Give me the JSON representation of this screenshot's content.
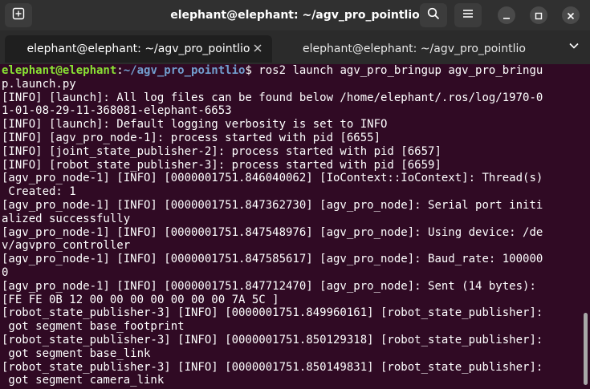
{
  "window": {
    "title": "elephant@elephant: ~/agv_pro_pointlio"
  },
  "tabs": [
    {
      "label": "elephant@elephant: ~/agv_pro_pointlio",
      "active": true
    },
    {
      "label": "elephant@elephant: ~/agv_pro_pointlio",
      "active": false
    }
  ],
  "icons": {
    "new_tab": "new-tab-icon",
    "search": "search-icon",
    "menu": "hamburger-menu-icon",
    "minimize": "minimize-icon",
    "maximize": "maximize-icon",
    "close": "close-icon",
    "tab_close": "close-icon",
    "tab_menu": "chevron-down-icon"
  },
  "colors": {
    "terminal_bg": "#300a24",
    "prompt_user": "#8ae234",
    "prompt_path": "#729fcf",
    "text": "#ffffff"
  },
  "terminal": {
    "prompt_user": "elephant@elephant",
    "prompt_sep": ":",
    "prompt_path": "~/agv_pro_pointlio",
    "prompt_cmd": "$ ros2 launch agv_pro_bringup agv_pro_bringu",
    "lines": [
      "p.launch.py",
      "[INFO] [launch]: All log files can be found below /home/elephant/.ros/log/1970-0",
      "1-01-08-29-11-368081-elephant-6653",
      "[INFO] [launch]: Default logging verbosity is set to INFO",
      "[INFO] [agv_pro_node-1]: process started with pid [6655]",
      "[INFO] [joint_state_publisher-2]: process started with pid [6657]",
      "[INFO] [robot_state_publisher-3]: process started with pid [6659]",
      "[agv_pro_node-1] [INFO] [0000001751.846040062] [IoContext::IoContext]: Thread(s)",
      " Created: 1",
      "[agv_pro_node-1] [INFO] [0000001751.847362730] [agv_pro_node]: Serial port initi",
      "alized successfully",
      "[agv_pro_node-1] [INFO] [0000001751.847548976] [agv_pro_node]: Using device: /de",
      "v/agvpro_controller",
      "[agv_pro_node-1] [INFO] [0000001751.847585617] [agv_pro_node]: Baud_rate: 100000",
      "0",
      "[agv_pro_node-1] [INFO] [0000001751.847712470] [agv_pro_node]: Sent (14 bytes):",
      "[FE FE 0B 12 00 00 00 00 00 00 00 7A 5C ]",
      "[robot_state_publisher-3] [INFO] [0000001751.849960161] [robot_state_publisher]:",
      " got segment base_footprint",
      "[robot_state_publisher-3] [INFO] [0000001751.850129318] [robot_state_publisher]:",
      " got segment base_link",
      "[robot_state_publisher-3] [INFO] [0000001751.850149831] [robot_state_publisher]:",
      " got segment camera_link"
    ]
  }
}
